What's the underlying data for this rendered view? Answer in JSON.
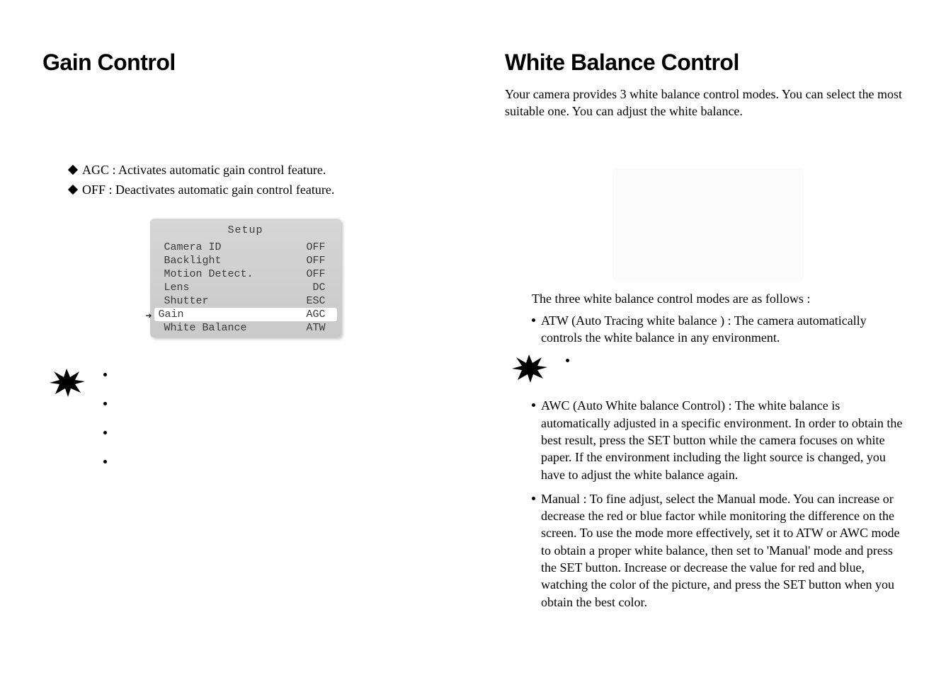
{
  "left": {
    "heading": "Gain Control",
    "bullets": [
      "AGC : Activates automatic gain control feature.",
      "OFF : Deactivates automatic gain control feature."
    ],
    "osd": {
      "title": "Setup",
      "rows": [
        {
          "label": "Camera ID",
          "value": "OFF"
        },
        {
          "label": "Backlight",
          "value": "OFF"
        },
        {
          "label": "Motion Detect.",
          "value": "OFF"
        },
        {
          "label": "Lens",
          "value": "DC"
        },
        {
          "label": "Shutter",
          "value": "ESC"
        },
        {
          "label": "Gain",
          "value": "AGC",
          "highlight": true
        },
        {
          "label": "White Balance",
          "value": "ATW"
        }
      ]
    }
  },
  "right": {
    "heading": "White Balance Control",
    "intro": "Your camera provides 3 white balance control modes. You can select the most suitable one. You can adjust the white balance.",
    "modes_intro": "The three white balance control modes are as follows :",
    "atw": "ATW (Auto Tracing white balance ) : The camera automatically controls the white balance in any environment.",
    "awc": "AWC (Auto White balance Control) : The white balance is automatically adjusted in a specific environment. In order to obtain the best result, press the SET button while the camera focuses on white paper. If the environment including the light source is changed, you have to adjust the white balance again.",
    "manual": "Manual : To fine adjust, select the Manual mode. You can increase or decrease the red or blue factor while monitoring the difference on the screen. To use the mode more effectively, set it to ATW or AWC mode to obtain a proper white balance, then set to 'Manual' mode and press the SET button. Increase or decrease the value for red and blue, watching the color of the picture, and press the SET button when you obtain the best color."
  }
}
